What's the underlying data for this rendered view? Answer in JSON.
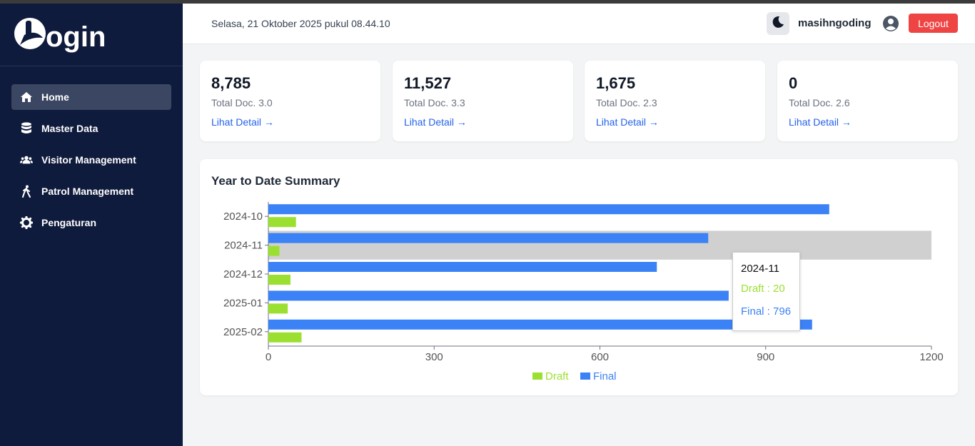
{
  "app": {
    "logo_text": "Login"
  },
  "sidebar": {
    "items": [
      {
        "label": "Home",
        "icon": "home-icon",
        "active": true
      },
      {
        "label": "Master Data",
        "icon": "database-icon",
        "active": false
      },
      {
        "label": "Visitor Management",
        "icon": "users-icon",
        "active": false
      },
      {
        "label": "Patrol Management",
        "icon": "walking-icon",
        "active": false
      },
      {
        "label": "Pengaturan",
        "icon": "gear-icon",
        "active": false
      }
    ]
  },
  "header": {
    "datetime": "Selasa, 21 Oktober 2025 pukul 08.44.10",
    "username": "masihngoding",
    "logout_label": "Logout",
    "theme_icon": "moon-icon",
    "user_icon": "user-circle-icon"
  },
  "cards": [
    {
      "value": "8,785",
      "label": "Total Doc. 3.0",
      "link": "Lihat Detail →"
    },
    {
      "value": "11,527",
      "label": "Total Doc. 3.3",
      "link": "Lihat Detail →"
    },
    {
      "value": "1,675",
      "label": "Total Doc. 2.3",
      "link": "Lihat Detail →"
    },
    {
      "value": "0",
      "label": "Total Doc. 2.6",
      "link": "Lihat Detail →"
    }
  ],
  "summary": {
    "title": "Year to Date Summary"
  },
  "colors": {
    "draft": "#9be030",
    "final": "#3b82f6",
    "sidebar_bg": "#0f1b3d",
    "logout": "#ef4444"
  },
  "chart_data": {
    "type": "bar",
    "orientation": "horizontal",
    "categories": [
      "2024-10",
      "2024-11",
      "2024-12",
      "2025-01",
      "2025-02"
    ],
    "series": [
      {
        "name": "Draft",
        "values": [
          50,
          20,
          40,
          35,
          60
        ]
      },
      {
        "name": "Final",
        "values": [
          1015,
          796,
          703,
          833,
          984
        ]
      }
    ],
    "xlim": [
      0,
      1200
    ],
    "xticks": [
      0,
      300,
      600,
      900,
      1200
    ],
    "legend_position": "bottom",
    "highlighted_category": "2024-11",
    "tooltip": {
      "title": "2024-11",
      "draft_text": "Draft : 20",
      "final_text": "Final : 796"
    }
  }
}
